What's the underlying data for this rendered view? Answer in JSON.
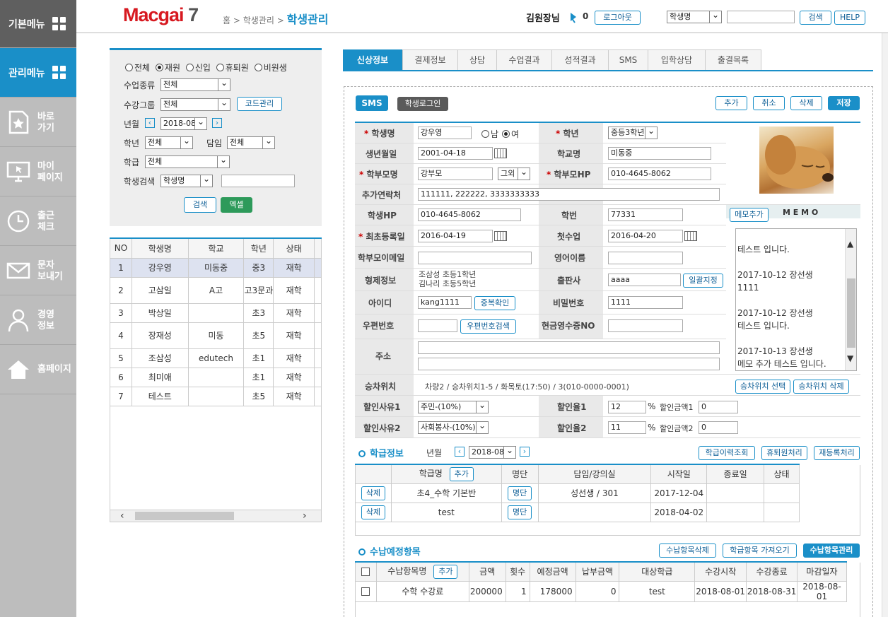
{
  "sidebar": {
    "top": "기본메뉴",
    "active": "관리메뉴",
    "items": [
      {
        "line1": "바로",
        "line2": "가기",
        "icon": "star-page-icon"
      },
      {
        "line1": "마이",
        "line2": "페이지",
        "icon": "monitor-cursor-icon"
      },
      {
        "line1": "출근",
        "line2": "체크",
        "icon": "clock-icon"
      },
      {
        "line1": "문자",
        "line2": "보내기",
        "icon": "envelope-icon"
      },
      {
        "line1": "경영",
        "line2": "정보",
        "icon": "person-icon"
      },
      {
        "line1": "홈페이지",
        "line2": "",
        "icon": "home-icon"
      }
    ]
  },
  "header": {
    "logo_main": "Macgai",
    "logo_num": "7",
    "crumb1": "홈 >",
    "crumb2": "학생관리 >",
    "crumb_current": "학생관리",
    "user": "김원장님",
    "msg_count": "0",
    "logout": "로그아웃",
    "search_type": "학생명",
    "search_btn": "검색",
    "help_btn": "HELP"
  },
  "filter": {
    "status_options": [
      "전체",
      "재원",
      "신입",
      "휴퇴원",
      "비원생"
    ],
    "status_selected": 1,
    "class_type_label": "수업종류",
    "class_type_value": "전체",
    "group_label": "수강그룹",
    "group_value": "전체",
    "code_btn": "코드관리",
    "month_label": "년월",
    "month_value": "2018-08",
    "grade_label": "학년",
    "grade_value": "전체",
    "teacher_label": "담임",
    "teacher_value": "전체",
    "class_label": "학급",
    "class_value": "전체",
    "search_label": "학생검색",
    "search_type": "학생명",
    "search_btn": "검색",
    "excel_btn": "엑셀"
  },
  "list": {
    "headers": [
      "NO",
      "학생명",
      "학교",
      "학년",
      "상태"
    ],
    "rows": [
      [
        "1",
        "강우영",
        "미동중",
        "중3",
        "재학"
      ],
      [
        "2",
        "고삼일",
        "A고",
        "고3문과",
        "재학"
      ],
      [
        "3",
        "박상일",
        "",
        "초3",
        "재학"
      ],
      [
        "4",
        "장재성",
        "미동",
        "초5",
        "재학"
      ],
      [
        "5",
        "조삼성",
        "edutech",
        "초1",
        "재학"
      ],
      [
        "6",
        "최미애",
        "",
        "초1",
        "재학"
      ],
      [
        "7",
        "테스트",
        "",
        "초5",
        "재학"
      ]
    ]
  },
  "tabs": [
    "신상정보",
    "결제정보",
    "상담",
    "수업결과",
    "성적결과",
    "SMS",
    "입학상담",
    "출결목록"
  ],
  "actions": {
    "sms": "SMS",
    "student_login": "학생로그인",
    "add": "추가",
    "cancel": "취소",
    "delete": "삭제",
    "save": "저장"
  },
  "form": {
    "name_label": "학생명",
    "name": "강우영",
    "gender_m": "남",
    "gender_f": "여",
    "grade_label": "학년",
    "grade": "중등3학년",
    "birth_label": "생년월일",
    "birth": "2001-04-18",
    "school_label": "학교명",
    "school": "미동중",
    "parent_label": "학부모명",
    "parent": "강부모",
    "relation": "그외",
    "parent_hp_label": "학부모HP",
    "parent_hp": "010-4645-8062",
    "extra_label": "추가연락처",
    "extra": "111111, 222222, 3333333333",
    "hp_label": "학생HP",
    "hp": "010-4645-8062",
    "student_no_label": "학번",
    "student_no": "77331",
    "memo_add": "메모추가",
    "memo_title": "M E M O",
    "reg_label": "최초등록일",
    "reg": "2016-04-19",
    "first_class_label": "첫수업",
    "first_class": "2016-04-20",
    "email_label": "학부모이메일",
    "email": "",
    "english_label": "영어이름",
    "english": "",
    "sibling_label": "형제정보",
    "sibling1": "조삼성 초등1학년",
    "sibling2": "김나리 초등5학년",
    "publisher_label": "출판사",
    "publisher": "aaaa",
    "batch_btn": "일괄지정",
    "id_label": "아이디",
    "id": "kang1111",
    "dup_btn": "중복확인",
    "pw_label": "비밀번호",
    "pw": "1111",
    "zip_label": "우편번호",
    "zip_btn": "우편번호검색",
    "receipt_label": "현금영수증NO",
    "addr_label": "주소",
    "bus_label": "승차위치",
    "bus": "차량2 / 승차위치1-5 / 화목토(17:50) / 3(010-0000-0001)",
    "bus_select": "승차위치 선택",
    "bus_delete": "승차위치 삭제",
    "disc1_label": "할인사유1",
    "disc1": "주민-(10%)",
    "rate1_label": "할인율1",
    "rate1": "12",
    "amt1_label": "할인금액1",
    "amt1": "0",
    "disc2_label": "할인사유2",
    "disc2": "사회봉사-(10%)",
    "rate2_label": "할인율2",
    "rate2": "11",
    "amt2_label": "할인금액2",
    "amt2": "0",
    "pct": "%"
  },
  "memo": "테스트 입니다.\n\n2017-10-12 장선생\n1111\n\n2017-10-12 장선생\n테스트 입니다.\n\n2017-10-13 장선생\n메모 추가 테스트 입니다.",
  "class_info": {
    "title": "학급정보",
    "month_label": "년월",
    "month": "2018-08",
    "history_btn": "학급이력조회",
    "withdraw_btn": "휴퇴원처리",
    "reenroll_btn": "재등록처리",
    "headers": [
      "학급명",
      "명단",
      "담임/강의실",
      "시작일",
      "종료일",
      "상태"
    ],
    "add_btn": "추가",
    "rows": [
      {
        "del": "삭제",
        "name": "초4_수학 기본반",
        "list": "명단",
        "teacher": "성선생 / 301",
        "start": "2017-12-04",
        "end": "",
        "status": ""
      },
      {
        "del": "삭제",
        "name": "test",
        "list": "명단",
        "teacher": "",
        "start": "2018-04-02",
        "end": "",
        "status": ""
      }
    ]
  },
  "payment": {
    "title": "수납예정항목",
    "del_btn": "수납항목삭제",
    "import_btn": "학급항목 가져오기",
    "manage_btn": "수납항목관리",
    "headers": [
      "수납항목명",
      "금액",
      "횟수",
      "예정금액",
      "납부금액",
      "대상학급",
      "수강시작",
      "수강종료",
      "마감일자"
    ],
    "add_btn": "추가",
    "rows": [
      [
        "수학 수강료",
        "200000",
        "1",
        "178000",
        "0",
        "test",
        "2018-08-01",
        "2018-08-31",
        "2018-08-01"
      ]
    ]
  }
}
